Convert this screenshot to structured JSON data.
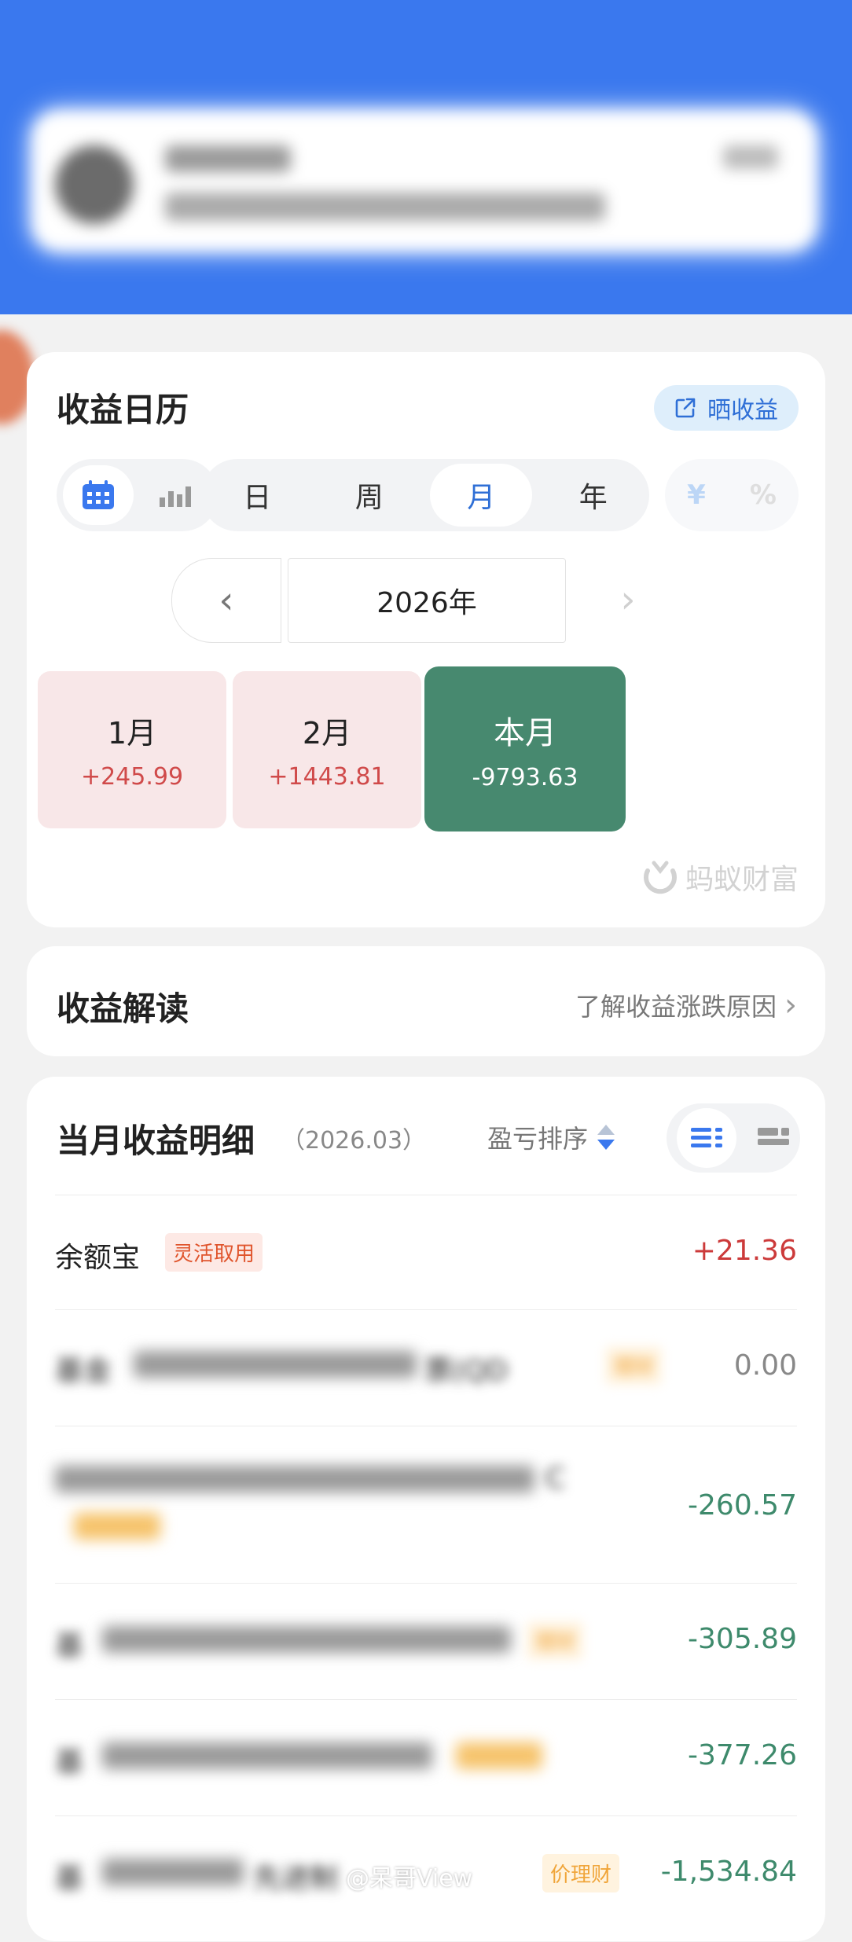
{
  "calendar": {
    "title": "收益日历",
    "share_label": "晒收益",
    "period_tabs": [
      "日",
      "周",
      "月",
      "年"
    ],
    "selected_period": "月",
    "unit_options": [
      "¥",
      "%"
    ],
    "year": "2026年",
    "months": [
      {
        "name": "1月",
        "value": "+245.99"
      },
      {
        "name": "2月",
        "value": "+1443.81"
      },
      {
        "name": "本月",
        "value": "-9793.63"
      }
    ],
    "brand": "蚂蚁财富"
  },
  "interpret": {
    "title": "收益解读",
    "link": "了解收益涨跌原因"
  },
  "detail": {
    "title": "当月收益明细",
    "period": "（2026.03）",
    "sort_label": "盈亏排序",
    "rows": [
      {
        "name": "余额宝",
        "badge": "灵活取用",
        "amount": "+21.36"
      },
      {
        "name": "基金",
        "name_tail": "票(QD",
        "badge": "理财",
        "amount": "0.00"
      },
      {
        "name": "",
        "name_tail": "C",
        "badge": "",
        "amount": "-260.57"
      },
      {
        "name": "基",
        "badge": "理财",
        "amount": "-305.89"
      },
      {
        "name": "基",
        "badge": "",
        "amount": "-377.26"
      },
      {
        "name": "基",
        "name_tail": "先进制",
        "badge": "价理财",
        "amount": "-1,534.84"
      }
    ]
  },
  "watermark": "@呆哥View",
  "colors": {
    "header_blue": "#3a78ee",
    "gain_red": "#cc3a3a",
    "loss_green": "#3e8a6c",
    "current_month": "#47896f"
  }
}
